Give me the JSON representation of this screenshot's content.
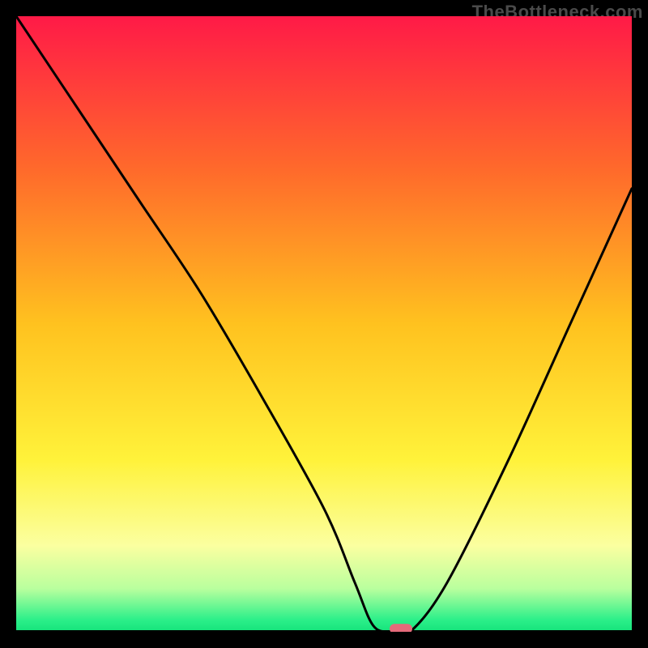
{
  "watermark": "TheBottleneck.com",
  "chart_data": {
    "type": "line",
    "title": "",
    "xlabel": "",
    "ylabel": "",
    "xlim": [
      0,
      100
    ],
    "ylim": [
      0,
      100
    ],
    "grid": false,
    "series": [
      {
        "name": "curve",
        "x": [
          0,
          10,
          20,
          30,
          40,
          50,
          55,
          58,
          61,
          64,
          70,
          80,
          90,
          100
        ],
        "y": [
          100,
          85,
          70,
          55,
          38,
          20,
          8,
          1,
          0,
          0,
          8,
          28,
          50,
          72
        ]
      }
    ],
    "marker": {
      "x": 62.5,
      "y": 0.5
    },
    "gradient_stops": [
      {
        "offset": 0,
        "color": "#ff1a47"
      },
      {
        "offset": 25,
        "color": "#ff6a2b"
      },
      {
        "offset": 50,
        "color": "#ffc21f"
      },
      {
        "offset": 72,
        "color": "#fff23a"
      },
      {
        "offset": 86,
        "color": "#fbffa0"
      },
      {
        "offset": 93,
        "color": "#b9ff9e"
      },
      {
        "offset": 98,
        "color": "#2df08a"
      },
      {
        "offset": 100,
        "color": "#14e27a"
      }
    ]
  }
}
